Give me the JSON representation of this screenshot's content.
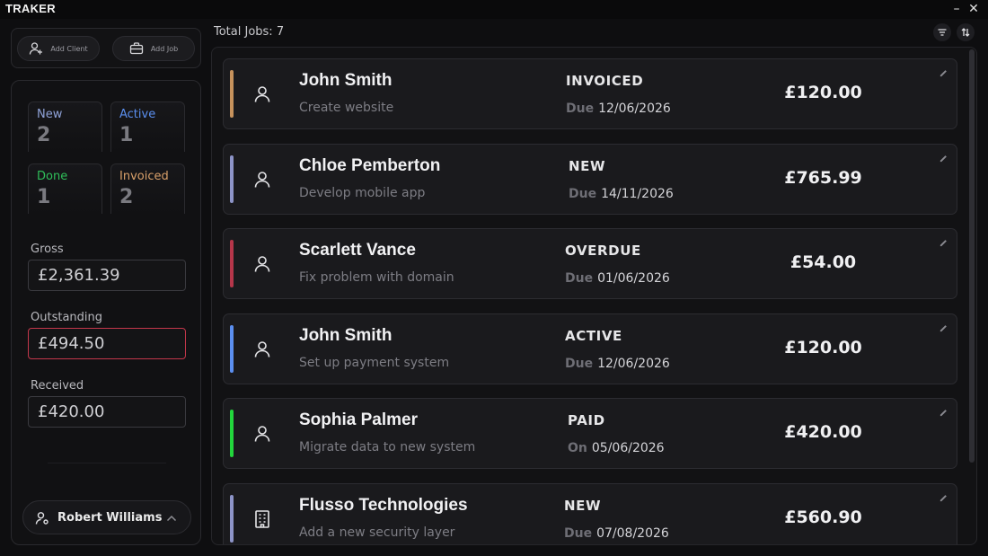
{
  "window": {
    "title": "TRAKER",
    "minimize_label": "–",
    "close_label": "✕"
  },
  "actions": {
    "add_client_label": "Add Client",
    "add_job_label": "Add Job"
  },
  "stats": {
    "new": {
      "label": "New",
      "value": "2"
    },
    "active": {
      "label": "Active",
      "value": "1"
    },
    "done": {
      "label": "Done",
      "value": "1"
    },
    "invoiced": {
      "label": "Invoiced",
      "value": "2"
    }
  },
  "money": {
    "gross": {
      "label": "Gross",
      "value": "£2,361.39"
    },
    "outstanding": {
      "label": "Outstanding",
      "value": "£494.50"
    },
    "received": {
      "label": "Received",
      "value": "£420.00"
    }
  },
  "user": {
    "name": "Robert Williams"
  },
  "header": {
    "total_jobs_label": "Total Jobs:",
    "total_jobs_value": "7"
  },
  "jobs": [
    {
      "client": "John Smith",
      "description": "Create website",
      "status": "INVOICED",
      "date_label": "Due",
      "date": "12/06/2026",
      "amount": "£120.00",
      "accent": "#c6925c",
      "icon": "person-icon"
    },
    {
      "client": "Chloe Pemberton",
      "description": "Develop mobile app",
      "status": "NEW",
      "date_label": "Due",
      "date": "14/11/2026",
      "amount": "£765.99",
      "accent": "#8d94c8",
      "icon": "person-icon"
    },
    {
      "client": "Scarlett Vance",
      "description": "Fix problem with domain",
      "status": "OVERDUE",
      "date_label": "Due",
      "date": "01/06/2026",
      "amount": "£54.00",
      "accent": "#b5364a",
      "icon": "person-icon"
    },
    {
      "client": "John Smith",
      "description": "Set up payment system",
      "status": "ACTIVE",
      "date_label": "Due",
      "date": "12/06/2026",
      "amount": "£120.00",
      "accent": "#5b8ff0",
      "icon": "person-icon"
    },
    {
      "client": "Sophia Palmer",
      "description": "Migrate data to new system",
      "status": "PAID",
      "date_label": "On",
      "date": "05/06/2026",
      "amount": "£420.00",
      "accent": "#22d63c",
      "icon": "person-icon"
    },
    {
      "client": "Flusso Technologies",
      "description": "Add a new security layer",
      "status": "NEW",
      "date_label": "Due",
      "date": "07/08/2026",
      "amount": "£560.90",
      "accent": "#8d94c8",
      "icon": "building-icon"
    }
  ]
}
